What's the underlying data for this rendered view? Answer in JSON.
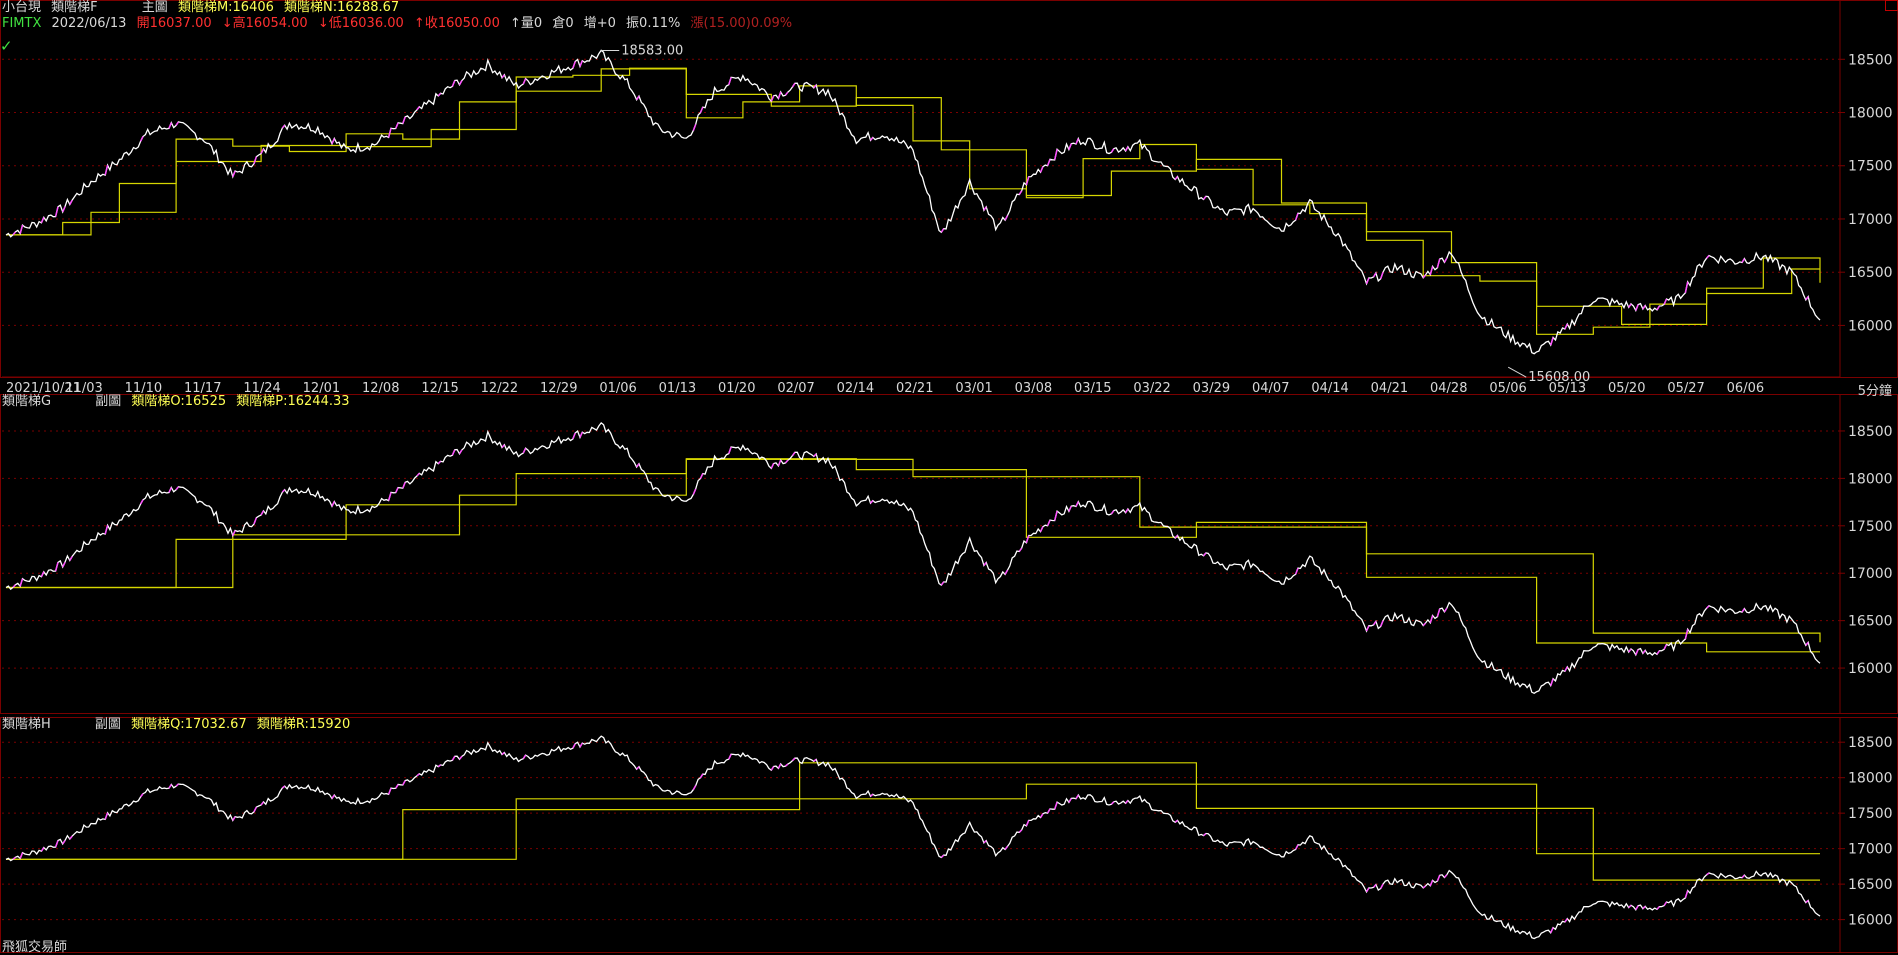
{
  "header1": {
    "symbol": "小台現",
    "indicator": "類階梯F",
    "chart_role": "主圖",
    "m_label": "類階梯M:16406",
    "n_label": "類階梯N:16288.67",
    "code": "FIMTX",
    "date": "2022/06/13",
    "open": "開16037.00",
    "high": "↓高16054.00",
    "low": "↓低16036.00",
    "close": "↑收16050.00",
    "vol": "↑量0",
    "oi": "倉0",
    "chg_oi": "增+0",
    "amp": "振0.11%",
    "change": "漲(15.00)0.09%"
  },
  "header2": {
    "indicator": "類階梯G",
    "chart_role": "副圖",
    "o_label": "類階梯O:16525",
    "p_label": "類階梯P:16244.33"
  },
  "header3": {
    "indicator": "類階梯H",
    "chart_role": "副圖",
    "q_label": "類階梯Q:17032.67",
    "r_label": "類階梯R:15920"
  },
  "footer": {
    "brand": "飛狐交易師",
    "timeframe": "5分鐘"
  },
  "colors": {
    "price_up": "#ff50ff",
    "price_down": "#ffffff",
    "ladder": "#d6d600",
    "grid": "#7a0000",
    "axis_text": "#d8d8d8",
    "bg": "#000000"
  },
  "chart_data": [
    {
      "type": "line",
      "name": "main",
      "x_labels": [
        "2021/10/21",
        "11/03",
        "11/10",
        "11/17",
        "11/24",
        "12/01",
        "12/08",
        "12/15",
        "12/22",
        "12/29",
        "01/06",
        "01/13",
        "01/20",
        "02/07",
        "02/14",
        "02/21",
        "03/01",
        "03/08",
        "03/15",
        "03/22",
        "03/29",
        "04/07",
        "04/14",
        "04/21",
        "04/28",
        "05/06",
        "05/13",
        "05/20",
        "05/27",
        "06/06"
      ],
      "y_ticks": [
        16000,
        16500,
        17000,
        17500,
        18000,
        18500
      ],
      "ylim": [
        15600,
        18700
      ],
      "price": [
        16850,
        16950,
        17100,
        17350,
        17550,
        17800,
        17900,
        17750,
        17400,
        17600,
        17900,
        17850,
        17650,
        17700,
        17900,
        18100,
        18300,
        18450,
        18250,
        18350,
        18450,
        18550,
        18250,
        17850,
        17750,
        18200,
        18350,
        18150,
        18250,
        18200,
        17750,
        17800,
        17650,
        16850,
        17350,
        16900,
        17350,
        17600,
        17750,
        17650,
        17700,
        17450,
        17250,
        17050,
        17100,
        16900,
        17150,
        16850,
        16400,
        16550,
        16450,
        16700,
        16100,
        15900,
        15750,
        15950,
        16250,
        16200,
        16150,
        16250,
        16650,
        16600,
        16650,
        16500,
        16050
      ],
      "annotations": [
        {
          "label": "18583.00",
          "x_index": 21,
          "y": 18583
        },
        {
          "label": "15608.00",
          "x_index": 53,
          "y": 15608
        }
      ],
      "series": [
        {
          "name": "類階梯M",
          "final": 16406
        },
        {
          "name": "類階梯N",
          "final": 16288.67
        }
      ]
    },
    {
      "type": "line",
      "name": "sub1",
      "y_ticks": [
        16000,
        16500,
        17000,
        17500,
        18000,
        18500
      ],
      "ylim": [
        15600,
        18700
      ],
      "series": [
        {
          "name": "類階梯O",
          "final": 16525
        },
        {
          "name": "類階梯P",
          "final": 16244.33
        }
      ]
    },
    {
      "type": "line",
      "name": "sub2",
      "y_ticks": [
        16000,
        16500,
        17000,
        17500,
        18000,
        18500
      ],
      "ylim": [
        15600,
        18700
      ],
      "series": [
        {
          "name": "類階梯Q",
          "final": 17032.67
        },
        {
          "name": "類階梯R",
          "final": 15920
        }
      ]
    }
  ]
}
